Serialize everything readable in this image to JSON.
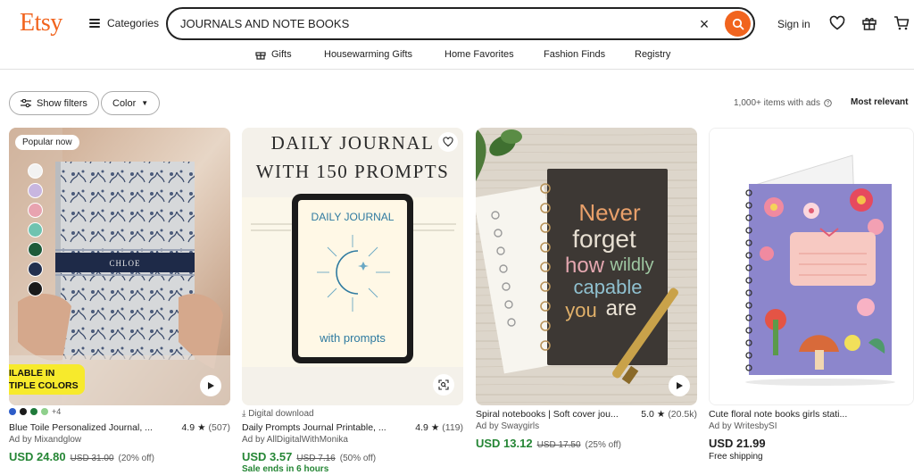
{
  "header": {
    "logo": "Etsy",
    "categories_label": "Categories",
    "search_value": "JOURNALS AND NOTE BOOKS",
    "signin_label": "Sign in"
  },
  "nav": {
    "items": [
      "Gifts",
      "Housewarming Gifts",
      "Home Favorites",
      "Fashion Finds",
      "Registry"
    ]
  },
  "filters": {
    "show_filters": "Show filters",
    "color": "Color",
    "results": "1,000+ items with ads",
    "sort": "Most relevant"
  },
  "colors": {
    "brand": "#f1641e",
    "price_green": "#258635",
    "muted": "#595959"
  },
  "listings": [
    {
      "badge": "Popular now",
      "banner_line1": "ILABLE IN",
      "banner_line2": "TIPLE COLORS",
      "journal_label": "CHLOE",
      "more_colors": "+4",
      "title": "Blue Toile Personalized Journal, ...",
      "rating": "4.9",
      "reviews": "(507)",
      "ad": "Ad by Mixandglow",
      "price": "USD 24.80",
      "original": "USD 31.00",
      "discount": "(20% off)"
    },
    {
      "image_text_1": "DAILY JOURNAL",
      "image_text_2": "WITH 150 PROMPTS",
      "screen_title": "DAILY JOURNAL",
      "screen_subtitle": "with prompts",
      "tag": "Digital download",
      "title": "Daily Prompts Journal Printable, ...",
      "rating": "4.9",
      "reviews": "(119)",
      "ad": "Ad by AllDigitalWithMonika",
      "price": "USD 3.57",
      "original": "USD 7.16",
      "discount": "(50% off)",
      "sale": "Sale ends in 6 hours"
    },
    {
      "quote_1": "Never",
      "quote_2": "forget",
      "quote_3": "how",
      "quote_4": "wildly",
      "quote_5": "capable",
      "quote_6": "you",
      "quote_7": "are",
      "title": "Spiral notebooks | Soft cover jou...",
      "rating": "5.0",
      "reviews": "(20.5k)",
      "ad": "Ad by Swaygirls",
      "price": "USD 13.12",
      "original": "USD 17.50",
      "discount": "(25% off)"
    },
    {
      "title": "Cute floral note books girls stati...",
      "ad": "Ad by WritesbySI",
      "price": "USD 21.99",
      "shipping": "Free shipping"
    }
  ]
}
